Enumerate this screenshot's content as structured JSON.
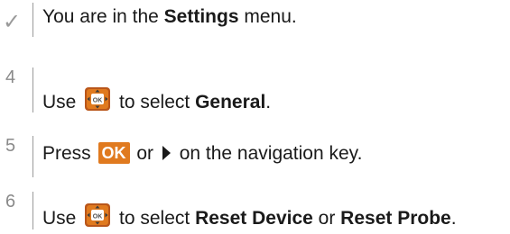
{
  "steps": [
    {
      "marker": "✓",
      "parts": [
        "You are in the ",
        "Settings",
        " menu."
      ]
    },
    {
      "marker": "4",
      "parts": [
        "Use ",
        " to select ",
        "General",
        "."
      ],
      "icon": "navigation-key-icon"
    },
    {
      "marker": "5",
      "parts": [
        "Press ",
        "OK",
        " or ",
        " on the navigation key."
      ],
      "icon": "arrow-right-icon"
    },
    {
      "marker": "6",
      "parts": [
        "Use ",
        " to select ",
        "Reset Device",
        " or ",
        "Reset Probe",
        "."
      ],
      "icon": "navigation-key-icon"
    }
  ],
  "colors": {
    "accent": "#e07a1f",
    "marker": "#8a8a8a",
    "text": "#1a1a1a"
  }
}
